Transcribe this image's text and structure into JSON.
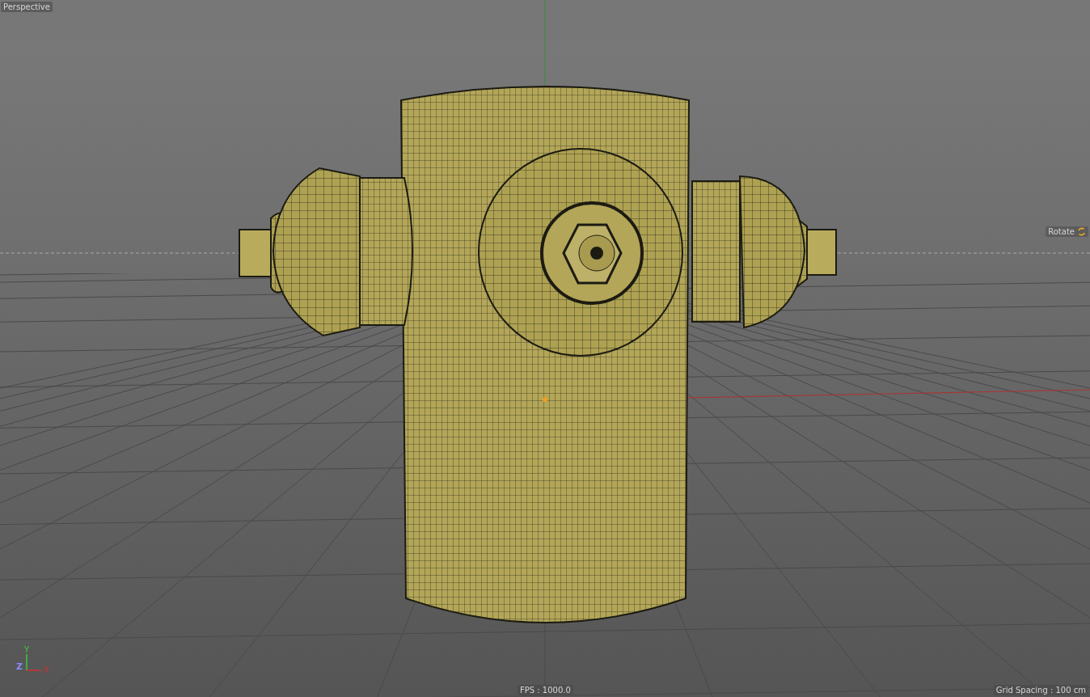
{
  "viewport": {
    "camera_label": "Perspective",
    "tool_label": "Rotate",
    "axis_gizmo": {
      "y": "Y",
      "z": "Z",
      "x": "X"
    },
    "fps": "FPS : 1000.0",
    "grid_spacing": "Grid Spacing : 100 cm"
  }
}
